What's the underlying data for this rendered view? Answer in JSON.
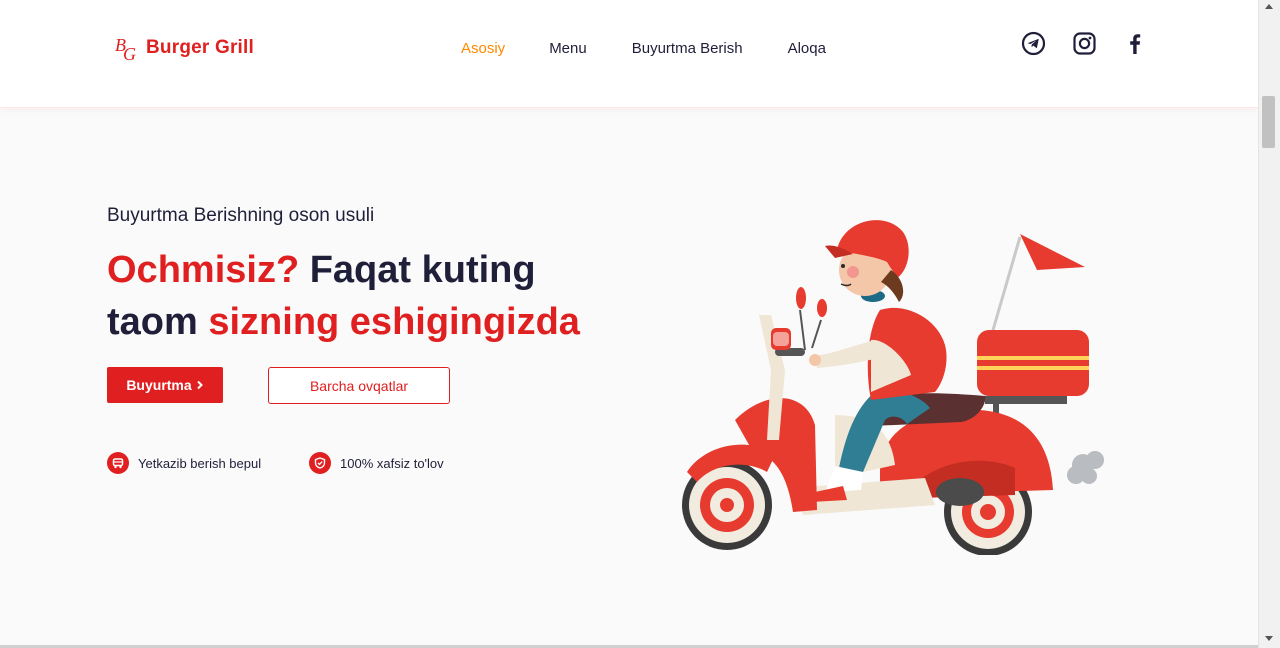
{
  "brand": {
    "name": "Burger Grill",
    "logo_icon": "bg-monogram-icon",
    "color": "#e02020"
  },
  "nav": {
    "items": [
      {
        "label": "Asosiy",
        "active": true
      },
      {
        "label": "Menu",
        "active": false
      },
      {
        "label": "Buyurtma Berish",
        "active": false
      },
      {
        "label": "Aloqa",
        "active": false
      }
    ],
    "active_color": "#ff8a00"
  },
  "social": [
    "telegram-icon",
    "instagram-icon",
    "facebook-icon"
  ],
  "hero": {
    "kicker": "Buyurtma Berishning oson usuli",
    "headline": {
      "part1": "Ochmisiz?",
      "part2": " Faqat kuting",
      "part3": "taom ",
      "part4": "sizning eshigingizda"
    },
    "primary_button": "Buyurtma",
    "primary_button_icon": "chevron-right-icon",
    "secondary_button": "Barcha ovqatlar",
    "features": [
      {
        "icon": "delivery-van-icon",
        "label": "Yetkazib berish bepul"
      },
      {
        "icon": "shield-check-icon",
        "label": "100% xafsiz to'lov"
      }
    ],
    "illustration": "delivery-scooter-illustration"
  },
  "colors": {
    "accent": "#e02020",
    "text": "#1f1f3a",
    "background": "#fafafa"
  }
}
